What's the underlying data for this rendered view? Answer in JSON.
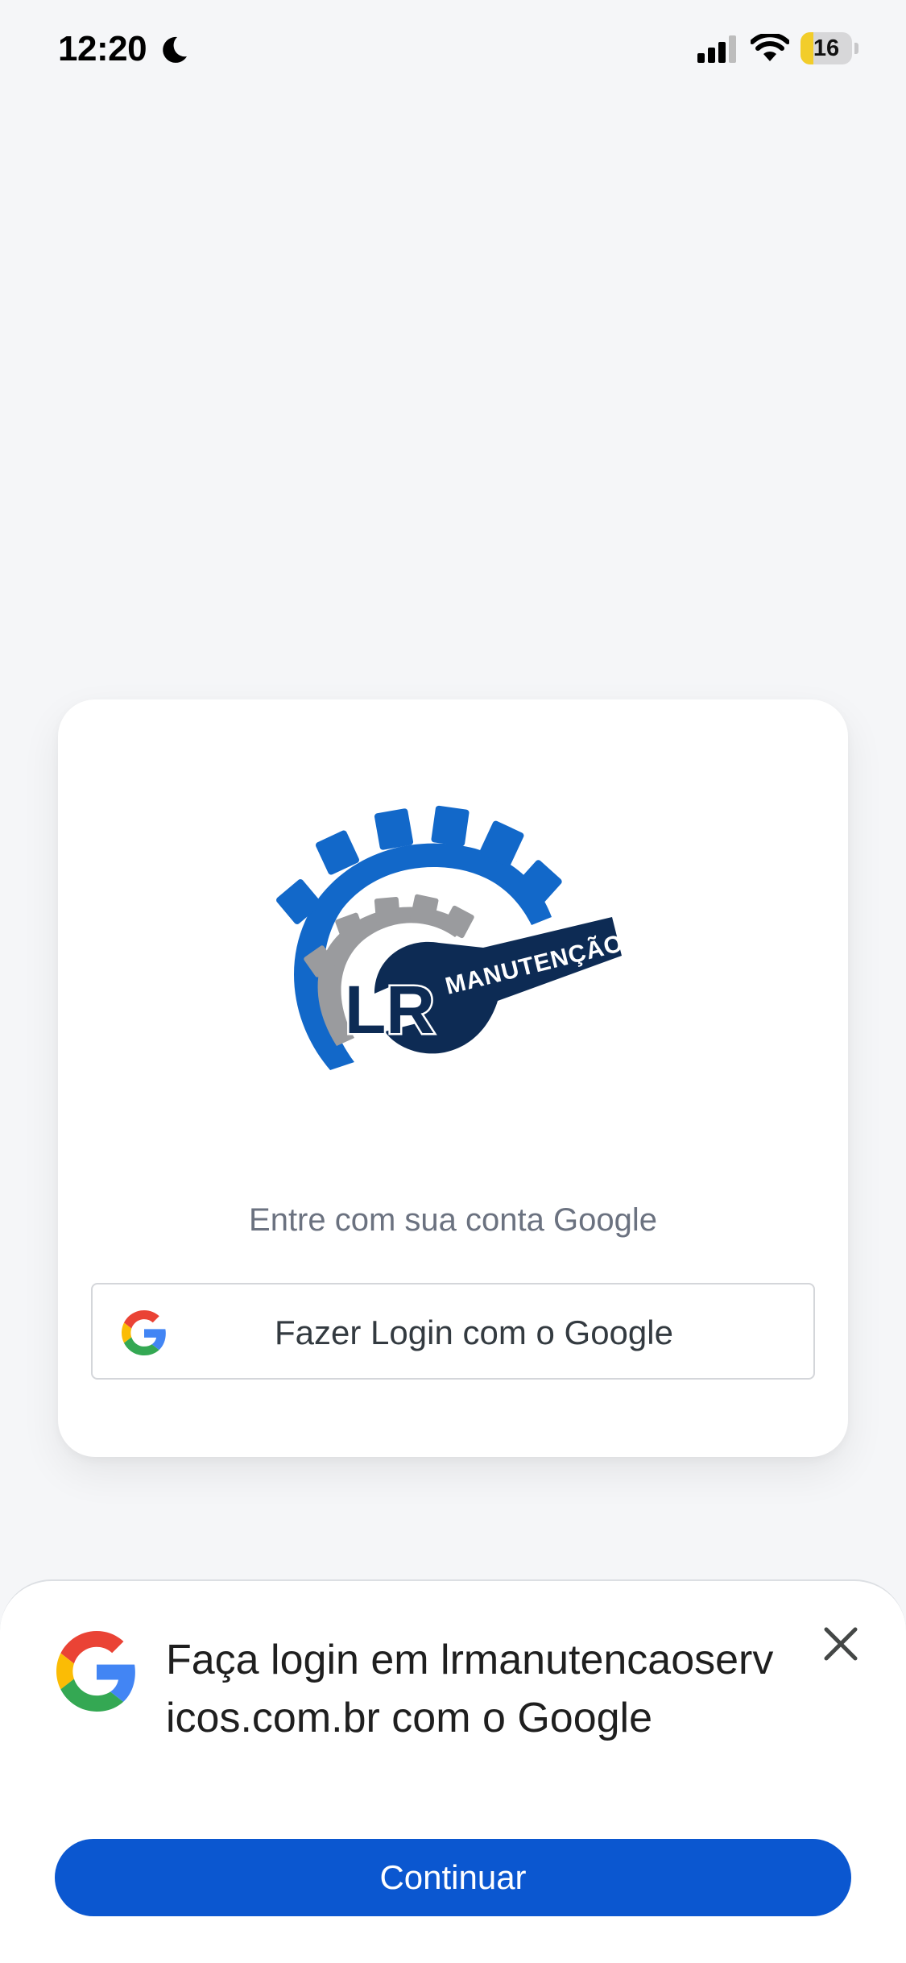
{
  "status_bar": {
    "time": "12:20",
    "battery_level": "16",
    "battery_fraction": 0.16,
    "icons": [
      "moon-icon",
      "cellular-signal-icon",
      "wifi-icon",
      "battery-charging-icon"
    ]
  },
  "card": {
    "logo": {
      "letters": "LR",
      "word": "MANUTENÇÃO"
    },
    "subtitle": "Entre com sua conta Google",
    "google_button_label": "Fazer Login com o Google"
  },
  "sheet": {
    "title": "Faça login em lrmanutencaoservicos.com.br com o Google",
    "continue_label": "Continuar"
  },
  "colors": {
    "background": "#f5f6f8",
    "card": "#ffffff",
    "primary_button": "#0b57d0",
    "logo_blue": "#1268c9",
    "logo_gray": "#9a9b9e",
    "logo_navy": "#0d2b54",
    "google_blue": "#4285F4",
    "google_red": "#EA4335",
    "google_yellow": "#FBBC05",
    "google_green": "#34A853"
  }
}
